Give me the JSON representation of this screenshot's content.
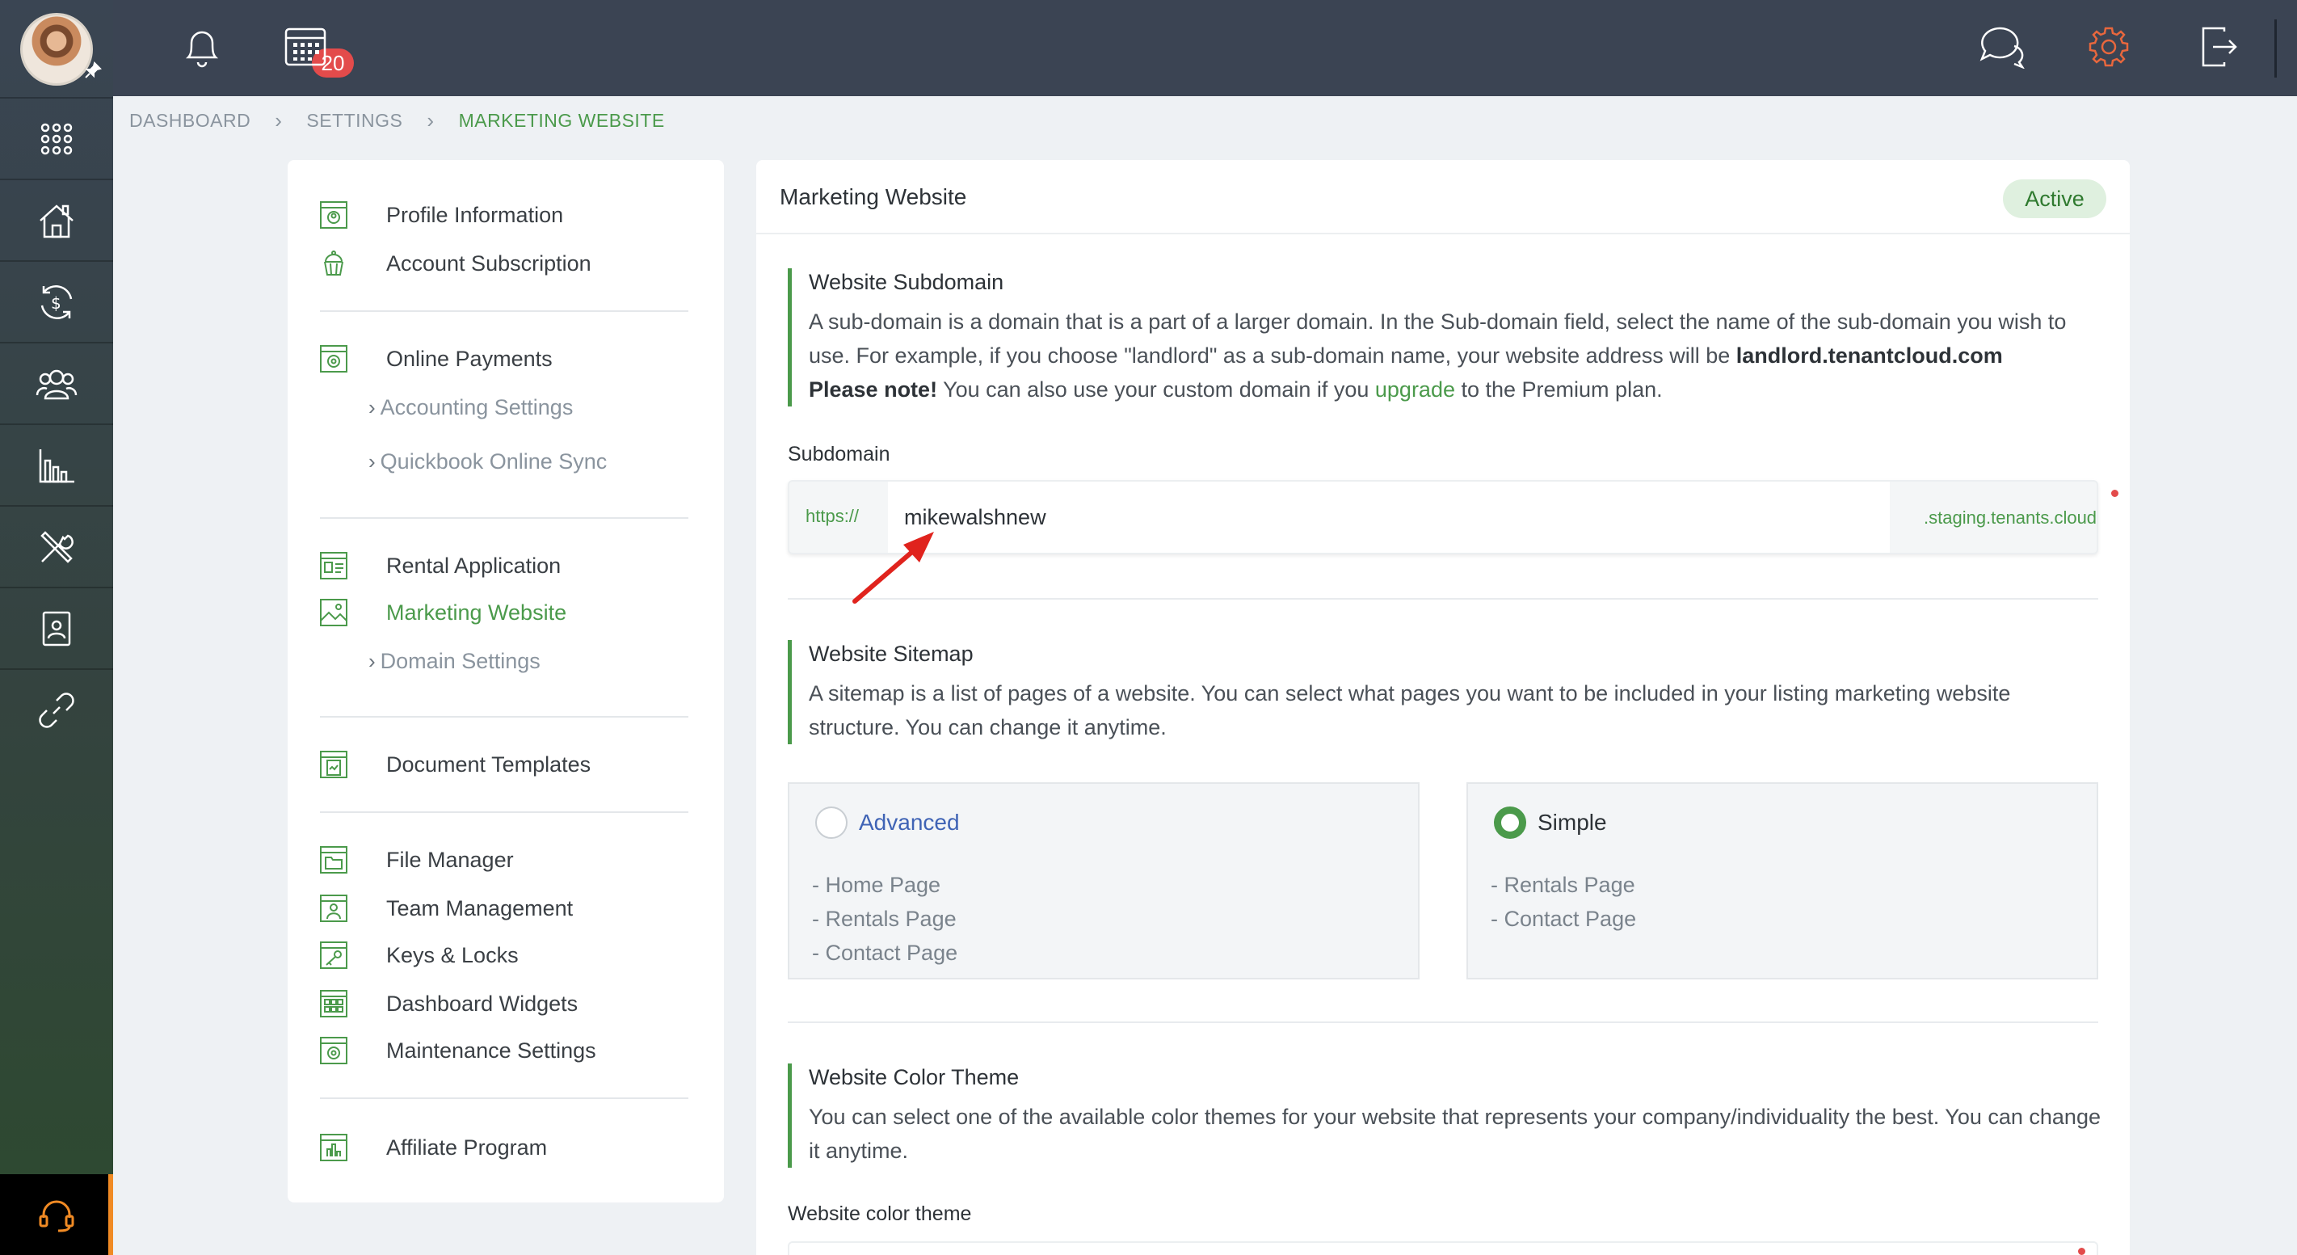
{
  "topbar": {
    "notification_count": "20"
  },
  "breadcrumb": {
    "items": [
      "DASHBOARD",
      "SETTINGS",
      "MARKETING WEBSITE"
    ]
  },
  "settings_menu": {
    "profile_information": "Profile Information",
    "account_subscription": "Account Subscription",
    "online_payments": "Online Payments",
    "accounting_settings": "Accounting Settings",
    "quickbook_online_sync": "Quickbook Online Sync",
    "rental_application": "Rental Application",
    "marketing_website": "Marketing Website",
    "domain_settings": "Domain Settings",
    "document_templates": "Document Templates",
    "file_manager": "File Manager",
    "team_management": "Team Management",
    "keys_locks": "Keys & Locks",
    "dashboard_widgets": "Dashboard Widgets",
    "maintenance_settings": "Maintenance Settings",
    "affiliate_program": "Affiliate Program"
  },
  "card": {
    "title": "Marketing Website",
    "status": "Active"
  },
  "subdomain_section": {
    "title": "Website Subdomain",
    "text_1": "A sub-domain is a domain that is a part of a larger domain. In the Sub-domain field, select the name of the sub-domain you wish to use. For example, if you choose \"landlord\" as a sub-domain name, your website address will be ",
    "example_domain": "landlord.tenantcloud.com",
    "please_note": "Please note!",
    "text_2": " You can also use your custom domain if you ",
    "upgrade_link": "upgrade",
    "text_3": " to the Premium plan.",
    "field_label": "Subdomain",
    "prefix": "https://",
    "value": "mikewalshnew",
    "suffix": ".staging.tenants.cloud"
  },
  "sitemap_section": {
    "title": "Website Sitemap",
    "text": "A sitemap is a list of pages of a website. You can select what pages you want to be included in your listing marketing website structure. You can change it anytime.",
    "advanced": {
      "label": "Advanced",
      "pages": [
        "- Home Page",
        "- Rentals Page",
        "- Contact Page"
      ]
    },
    "simple": {
      "label": "Simple",
      "pages": [
        "- Rentals Page",
        "- Contact Page"
      ]
    }
  },
  "color_section": {
    "title": "Website Color Theme",
    "text": "You can select one of the available color themes for your website that represents your company/individuality the best. You can change it anytime.",
    "field_label": "Website color theme"
  }
}
